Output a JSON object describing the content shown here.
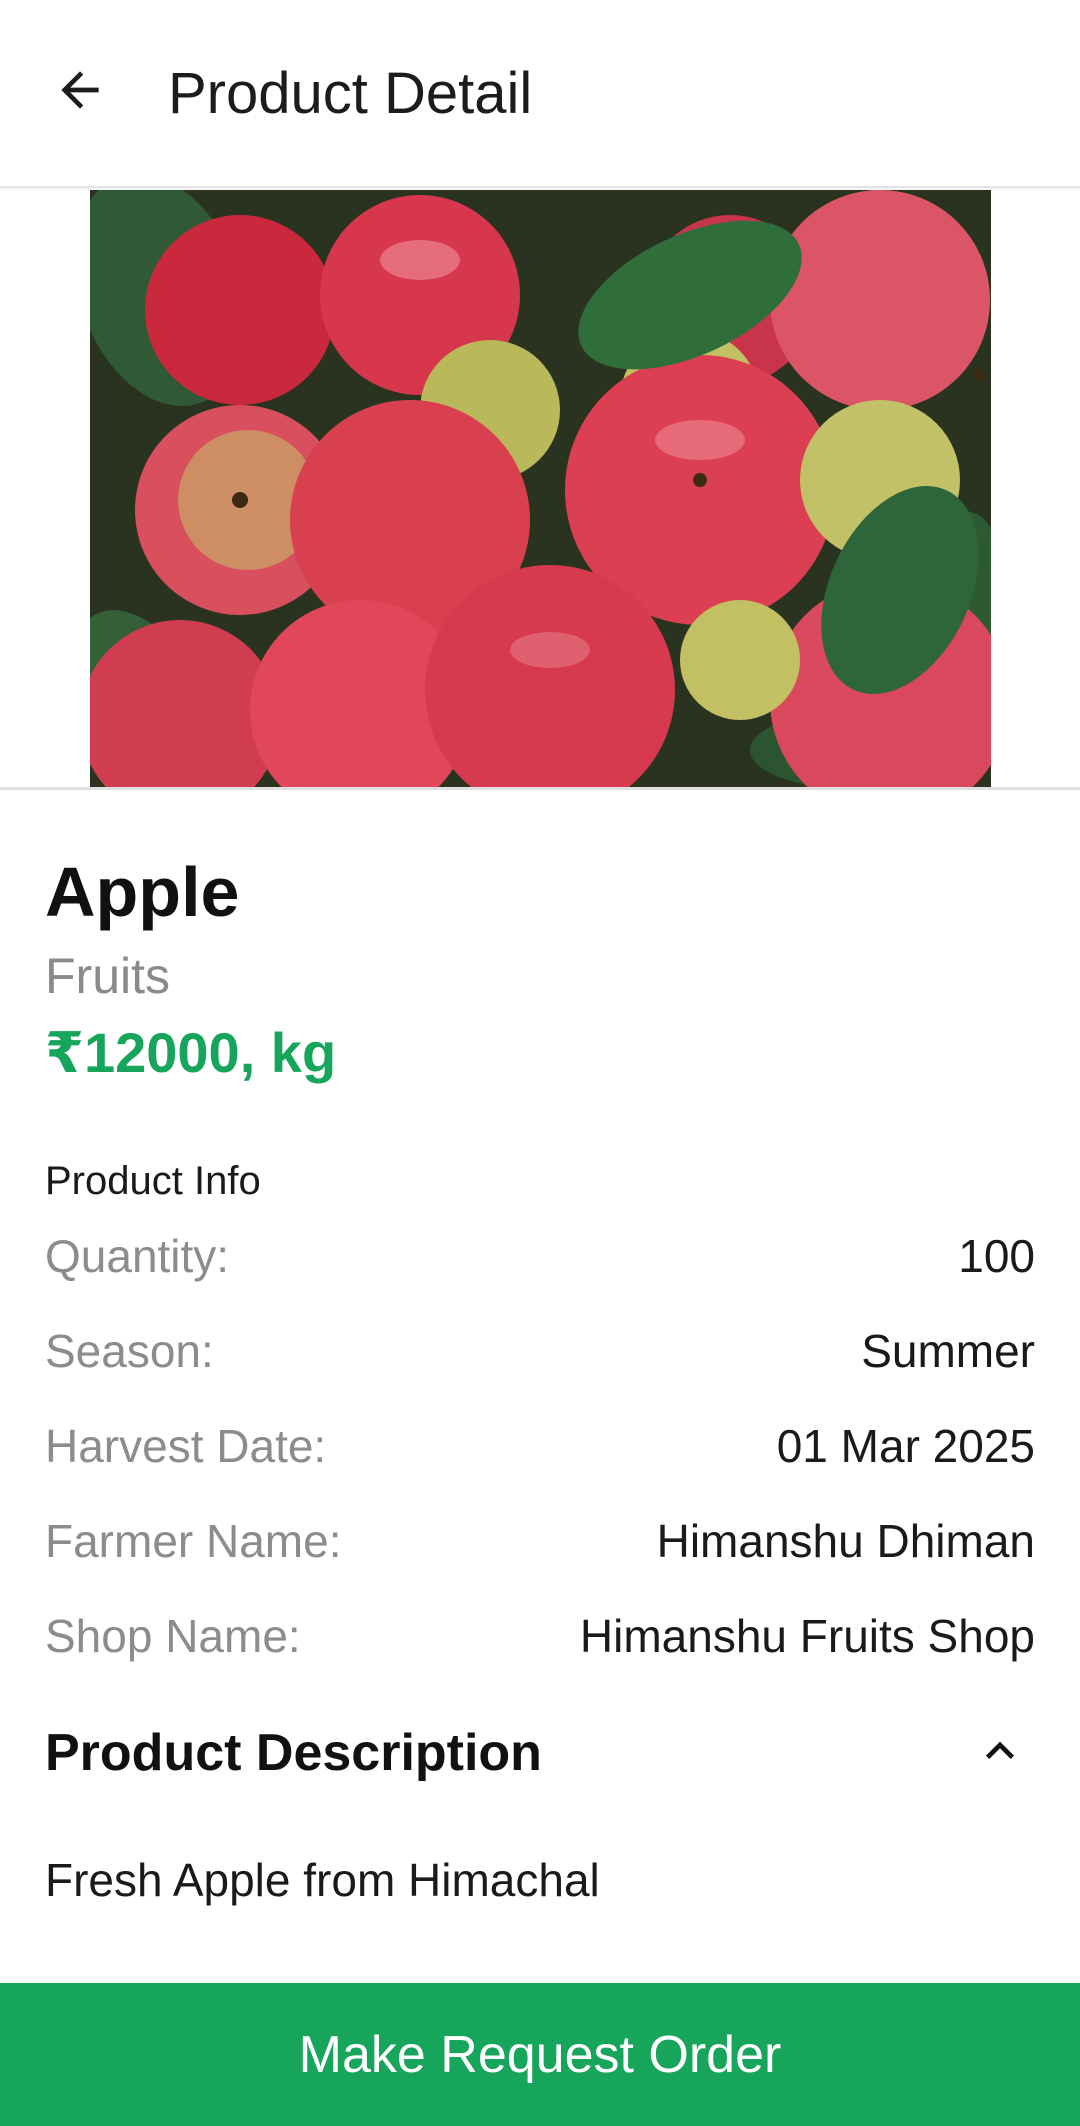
{
  "app_bar": {
    "title": "Product Detail",
    "back_icon": "arrow-left-icon"
  },
  "product": {
    "image_alt": "Red apples with green leaves",
    "name": "Apple",
    "category": "Fruits",
    "price": "₹12000, kg"
  },
  "info": {
    "title": "Product Info",
    "rows": [
      {
        "label": "Quantity:",
        "value": "100"
      },
      {
        "label": "Season:",
        "value": "Summer"
      },
      {
        "label": "Harvest Date:",
        "value": "01 Mar 2025"
      },
      {
        "label": "Farmer Name:",
        "value": "Himanshu Dhiman"
      },
      {
        "label": "Shop Name:",
        "value": "Himanshu Fruits Shop"
      }
    ]
  },
  "description": {
    "title": "Product Description",
    "toggle_icon": "chevron-up-icon",
    "text": "Fresh Apple from Himachal"
  },
  "cta": {
    "label": "Make Request Order"
  },
  "colors": {
    "accent": "#17a55b",
    "muted_text": "#8a8a8a"
  }
}
